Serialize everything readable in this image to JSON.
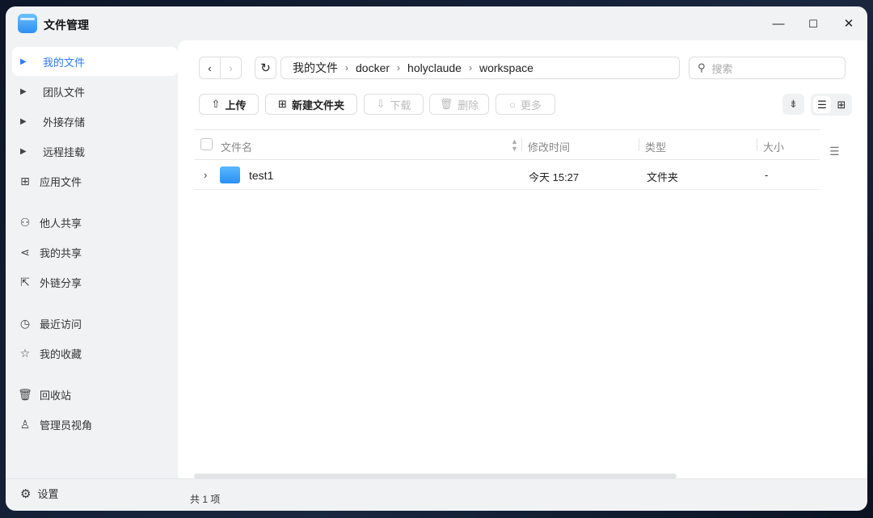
{
  "app": {
    "title": "文件管理"
  },
  "window_controls": {
    "minimize": "—",
    "maximize": "☐",
    "close": "✕"
  },
  "sidebar": {
    "items": [
      {
        "label": "我的文件",
        "icon": "caret-right-icon",
        "active": true
      },
      {
        "label": "团队文件",
        "icon": "caret-right-icon"
      },
      {
        "label": "外接存储",
        "icon": "caret-right-icon"
      },
      {
        "label": "远程挂载",
        "icon": "caret-right-icon"
      },
      {
        "label": "应用文件",
        "icon": "apps-icon"
      },
      {
        "label": "他人共享",
        "icon": "users-icon"
      },
      {
        "label": "我的共享",
        "icon": "share-icon"
      },
      {
        "label": "外链分享",
        "icon": "external-link-icon"
      },
      {
        "label": "最近访问",
        "icon": "clock-icon"
      },
      {
        "label": "我的收藏",
        "icon": "star-icon"
      },
      {
        "label": "回收站",
        "icon": "trash-icon"
      },
      {
        "label": "管理员视角",
        "icon": "admin-icon"
      }
    ],
    "settings": "设置"
  },
  "breadcrumb": [
    "我的文件",
    "docker",
    "holyclaude",
    "workspace"
  ],
  "search": {
    "placeholder": "搜索"
  },
  "toolbar": {
    "upload": "上传",
    "new_folder": "新建文件夹",
    "download": "下载",
    "delete": "删除",
    "more": "更多"
  },
  "table": {
    "headers": {
      "name": "文件名",
      "modified": "修改时间",
      "type": "类型",
      "size": "大小"
    },
    "rows": [
      {
        "name": "test1",
        "modified": "今天 15:27",
        "type": "文件夹",
        "size": "-"
      }
    ]
  },
  "status": {
    "count": "共 1 项"
  },
  "colors": {
    "accent": "#2f7bf5"
  }
}
